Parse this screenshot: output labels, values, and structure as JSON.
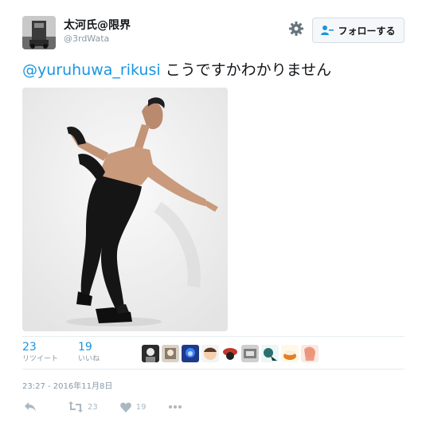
{
  "tweet": {
    "display_name": "太河氏@限界",
    "screen_name": "@3rdWata",
    "follow_label": "フォローする",
    "mention": "@yuruhuwa_rikusi",
    "text": " こうですかわかりません",
    "timestamp": "23:27 - 2016年11月8日"
  },
  "stats": {
    "retweets": {
      "count": "23",
      "label": "リツイート"
    },
    "likes": {
      "count": "19",
      "label": "いいね"
    }
  },
  "actions": {
    "retweet_count": "23",
    "like_count": "19"
  },
  "colors": {
    "link": "#1b95e0",
    "muted": "#8899a6",
    "icon": "#aab8c2"
  }
}
